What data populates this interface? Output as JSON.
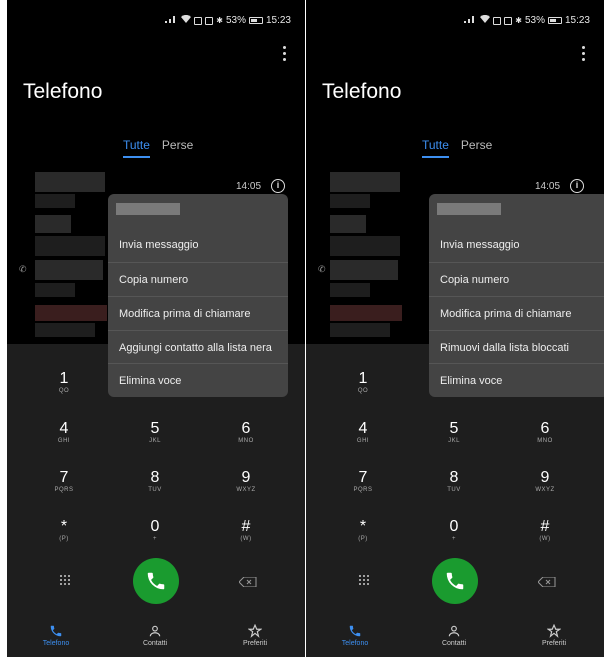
{
  "status": {
    "percent": "53%",
    "time": "15:23"
  },
  "app_title": "Telefono",
  "tabs": [
    {
      "label": "Tutte"
    },
    {
      "label": "Perse"
    }
  ],
  "call_log": {
    "time": "14:05"
  },
  "menus": {
    "left": [
      "Invia messaggio",
      "Copia numero",
      "Modifica prima di chiamare",
      "Aggiungi contatto alla lista nera",
      "Elimina voce"
    ],
    "right": [
      "Invia messaggio",
      "Copia numero",
      "Modifica prima di chiamare",
      "Rimuovi dalla lista bloccati",
      "Elimina voce"
    ]
  },
  "keypad": [
    {
      "num": "1",
      "sub": "QO"
    },
    {
      "num": "4",
      "sub": "GHI"
    },
    {
      "num": "5",
      "sub": "JKL"
    },
    {
      "num": "6",
      "sub": "MNO"
    },
    {
      "num": "7",
      "sub": "PQRS"
    },
    {
      "num": "8",
      "sub": "TUV"
    },
    {
      "num": "9",
      "sub": "WXYZ"
    },
    {
      "num": "*",
      "sub": "(P)"
    },
    {
      "num": "0",
      "sub": "+"
    },
    {
      "num": "#",
      "sub": "(W)"
    }
  ],
  "nav": [
    {
      "label": "Telefono",
      "icon": "phone-icon"
    },
    {
      "label": "Contatti",
      "icon": "contacts-icon"
    },
    {
      "label": "Preferiti",
      "icon": "star-icon"
    }
  ],
  "colors": {
    "accent": "#3d8ff0",
    "call_green": "#1a9b2f",
    "menu_bg": "#444444"
  }
}
